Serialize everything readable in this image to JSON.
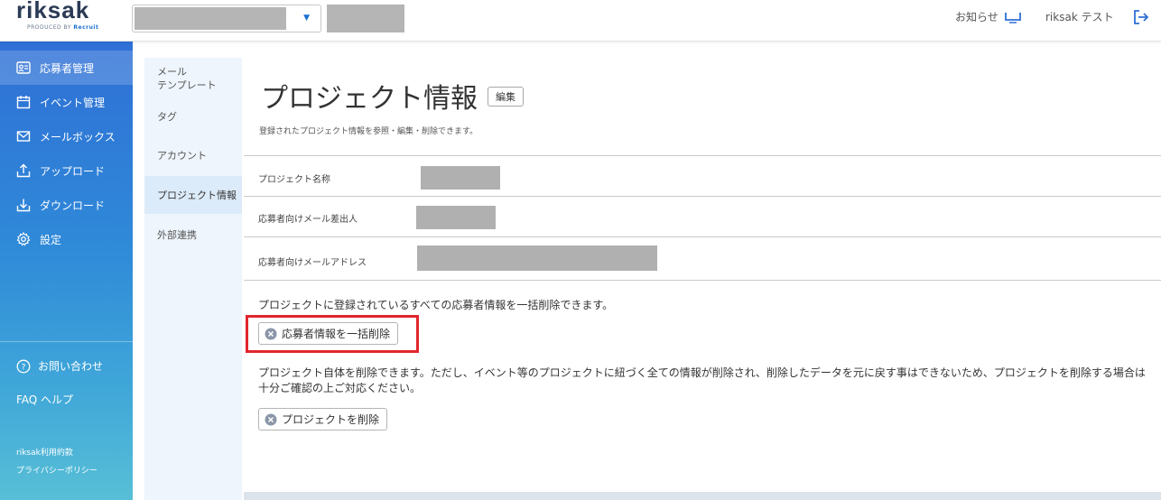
{
  "header": {
    "logo_text": "riksak",
    "logo_sub": "PRODUCED BY",
    "logo_brand": "Recruit",
    "notice_label": "お知らせ",
    "user_label": "riksak テスト"
  },
  "sidebar": {
    "items": [
      {
        "label": "応募者管理",
        "icon": "applicant-card-icon"
      },
      {
        "label": "イベント管理",
        "icon": "calendar-icon"
      },
      {
        "label": "メールボックス",
        "icon": "mail-icon"
      },
      {
        "label": "アップロード",
        "icon": "upload-icon"
      },
      {
        "label": "ダウンロード",
        "icon": "download-icon"
      },
      {
        "label": "設定",
        "icon": "gear-icon"
      }
    ],
    "contact_label": "お問い合わせ",
    "faq_label": "FAQ ヘルプ",
    "terms_label": "riksak利用約款",
    "privacy_label": "プライバシーポリシー"
  },
  "subnav": {
    "items": [
      {
        "label": "メール\nテンプレート"
      },
      {
        "label": "タグ"
      },
      {
        "label": "アカウント"
      },
      {
        "label": "プロジェクト情報"
      },
      {
        "label": "外部連携"
      }
    ]
  },
  "main": {
    "title": "プロジェクト情報",
    "edit_label": "編集",
    "description": "登録されたプロジェクト情報を参照・編集・削除できます。",
    "fields": [
      {
        "label": "プロジェクト名称"
      },
      {
        "label": "応募者向けメール差出人"
      },
      {
        "label": "応募者向けメールアドレス"
      }
    ],
    "bulk_delete_note": "プロジェクトに登録されているすべての応募者情報を一括削除できます。",
    "bulk_delete_label": "応募者情報を一括削除",
    "project_delete_note": "プロジェクト自体を削除できます。ただし、イベント等のプロジェクトに紐づく全ての情報が削除され、削除したデータを元に戻す事はできないため、プロジェクトを削除する場合は十分ご確認の上ご対応ください。",
    "project_delete_label": "プロジェクトを削除"
  },
  "colors": {
    "sidebar_top": "#2f6fd6",
    "sidebar_bottom": "#58bfd6",
    "highlight": "#e1262d",
    "subnav_bg": "#eef5fc"
  }
}
